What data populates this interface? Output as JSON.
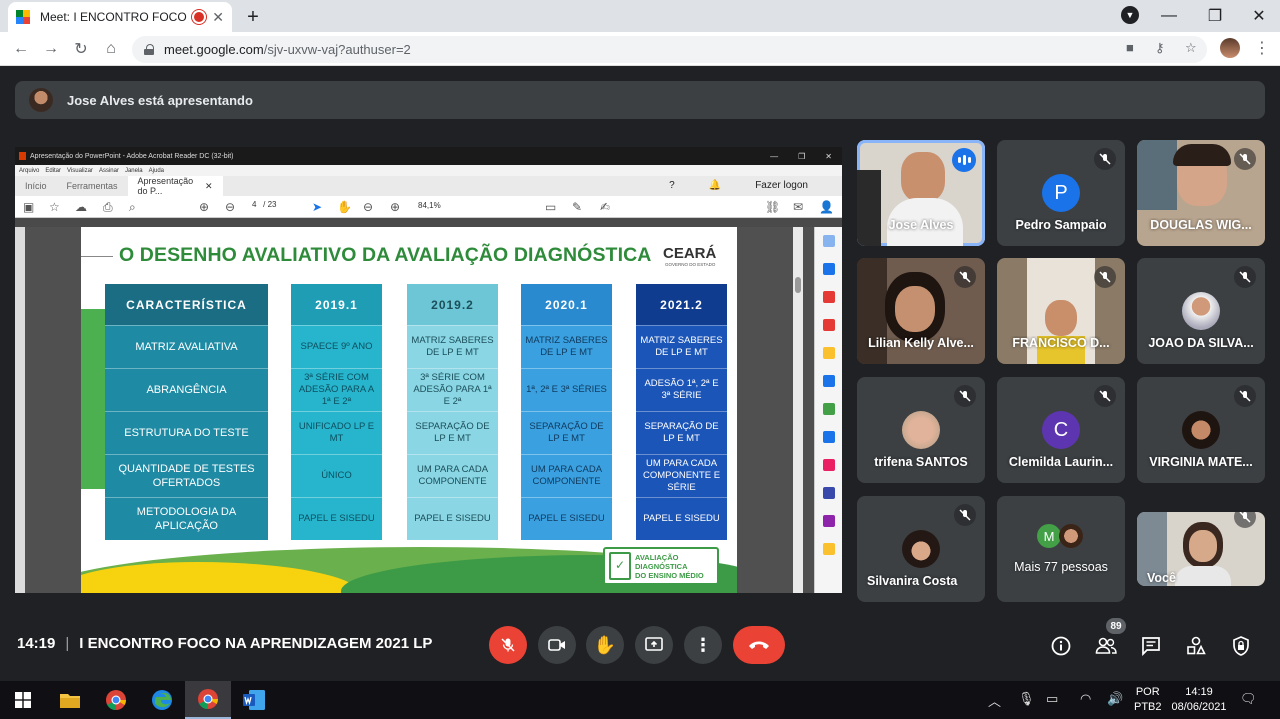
{
  "browser": {
    "tab_title": "Meet: I ENCONTRO FOCO NA",
    "url_host": "meet.google.com",
    "url_path": "/sjv-uxvw-vaj?authuser=2"
  },
  "meet": {
    "presenting_text": "Jose Alves está apresentando",
    "time": "14:19",
    "meeting_title": "I ENCONTRO FOCO NA APRENDIZAGEM 2021 LP",
    "participant_count": "89",
    "participants": [
      {
        "name": "Jose Alves",
        "kind": "video",
        "speaking": true
      },
      {
        "name": "Pedro Sampaio",
        "kind": "letter",
        "letter": "P",
        "color": "#1a73e8",
        "muted": true
      },
      {
        "name": "DOUGLAS WIG...",
        "kind": "video",
        "muted": true
      },
      {
        "name": "Lilian Kelly Alve...",
        "kind": "video",
        "muted": true
      },
      {
        "name": "FRANCISCO D...",
        "kind": "video",
        "muted": true
      },
      {
        "name": "JOAO DA SILVA...",
        "kind": "photo",
        "muted": true
      },
      {
        "name": "trifena SANTOS",
        "kind": "photo",
        "muted": true
      },
      {
        "name": "Clemilda Laurin...",
        "kind": "letter",
        "letter": "C",
        "color": "#5e35b1",
        "muted": true
      },
      {
        "name": "VIRGINIA MATE...",
        "kind": "photo",
        "muted": true
      },
      {
        "name": "Silvanira Costa",
        "kind": "photo",
        "muted": true
      },
      {
        "name": "Mais 77 pessoas",
        "kind": "more",
        "letter": "M"
      },
      {
        "name": "Você",
        "kind": "video",
        "muted": true
      }
    ]
  },
  "acrobat": {
    "window_title": "Apresentação do PowerPoint - Adobe Acrobat Reader DC (32-bit)",
    "menu": [
      "Arquivo",
      "Editar",
      "Visualizar",
      "Assinar",
      "Janela",
      "Ajuda"
    ],
    "tabs": [
      "Início",
      "Ferramentas",
      "Apresentação do P..."
    ],
    "login": "Fazer logon",
    "page_current": "4",
    "page_total": "/ 23",
    "zoom": "84,1%"
  },
  "slide": {
    "title": "O DESENHO AVALIATIVO DA AVALIAÇÃO DIAGNÓSTICA",
    "logo": "CEARÁ",
    "logo_sub": "GOVERNO DO ESTADO",
    "row_headers": [
      "CARACTERÍSTICA",
      "MATRIZ AVALIATIVA",
      "ABRANGÊNCIA",
      "ESTRUTURA DO TESTE",
      "QUANTIDADE DE TESTES OFERTADOS",
      "METODOLOGIA DA APLICAÇÃO"
    ],
    "columns": [
      {
        "year": "2019.1",
        "cells": [
          "SPAECE 9º ANO",
          "3ª SÉRIE COM ADESÃO PARA A 1ª E 2ª",
          "UNIFICADO LP E MT",
          "ÚNICO",
          "PAPEL E SISEDU"
        ]
      },
      {
        "year": "2019.2",
        "cells": [
          "MATRIZ SABERES DE LP E MT",
          "3ª SÉRIE COM ADESÃO PARA 1ª E 2ª",
          "SEPARAÇÃO DE LP E MT",
          "UM PARA CADA COMPONENTE",
          "PAPEL E SISEDU"
        ]
      },
      {
        "year": "2020.1",
        "cells": [
          "MATRIZ SABERES DE LP E MT",
          "1ª, 2ª E 3ª SÉRIES",
          "SEPARAÇÃO DE LP E MT",
          "UM PARA CADA COMPONENTE",
          "PAPEL E SISEDU"
        ]
      },
      {
        "year": "2021.2",
        "cells": [
          "MATRIZ SABERES DE LP E MT",
          "ADESÃO 1ª, 2ª E 3ª SÉRIE",
          "SEPARAÇÃO DE LP E MT",
          "UM PARA CADA COMPONENTE E SÉRIE",
          "PAPEL E SISEDU"
        ]
      }
    ],
    "badge_lines": [
      "AVALIAÇÃO",
      "DIAGNÓSTICA",
      "DO ENSINO MÉDIO"
    ]
  },
  "taskbar": {
    "lang": "POR",
    "lang2": "PTB2",
    "clock_time": "14:19",
    "clock_date": "08/06/2021"
  }
}
